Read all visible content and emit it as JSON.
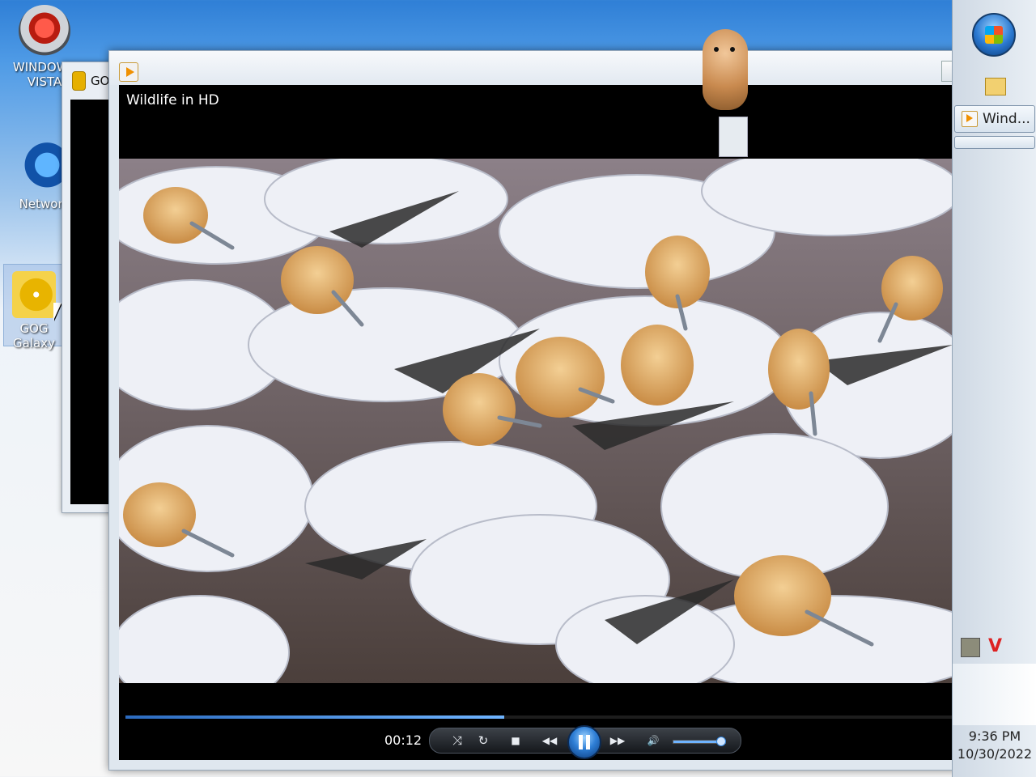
{
  "desktop": {
    "icons": [
      {
        "label": "WINDOWS VISTA",
        "icon": "vista-toy-icon"
      },
      {
        "label": "Network",
        "icon": "network-globe-icon"
      },
      {
        "label": "GOG Galaxy",
        "icon": "gog-disc-icon"
      }
    ]
  },
  "background_window": {
    "title": "GOG"
  },
  "player": {
    "video_title": "Wildlife in HD",
    "elapsed": "00:12",
    "progress_fraction": 0.45,
    "volume_fraction": 0.9,
    "buttons": {
      "shuffle": "⤨",
      "repeat": "↻",
      "stop": "■",
      "previous": "◀◀",
      "next": "▶▶",
      "mute": "🔊"
    },
    "accent_color": "#2f7fd6"
  },
  "taskbar": {
    "task_label": "Wind...",
    "tray_v": "V",
    "clock_time": "9:36 PM",
    "clock_date": "10/30/2022"
  }
}
